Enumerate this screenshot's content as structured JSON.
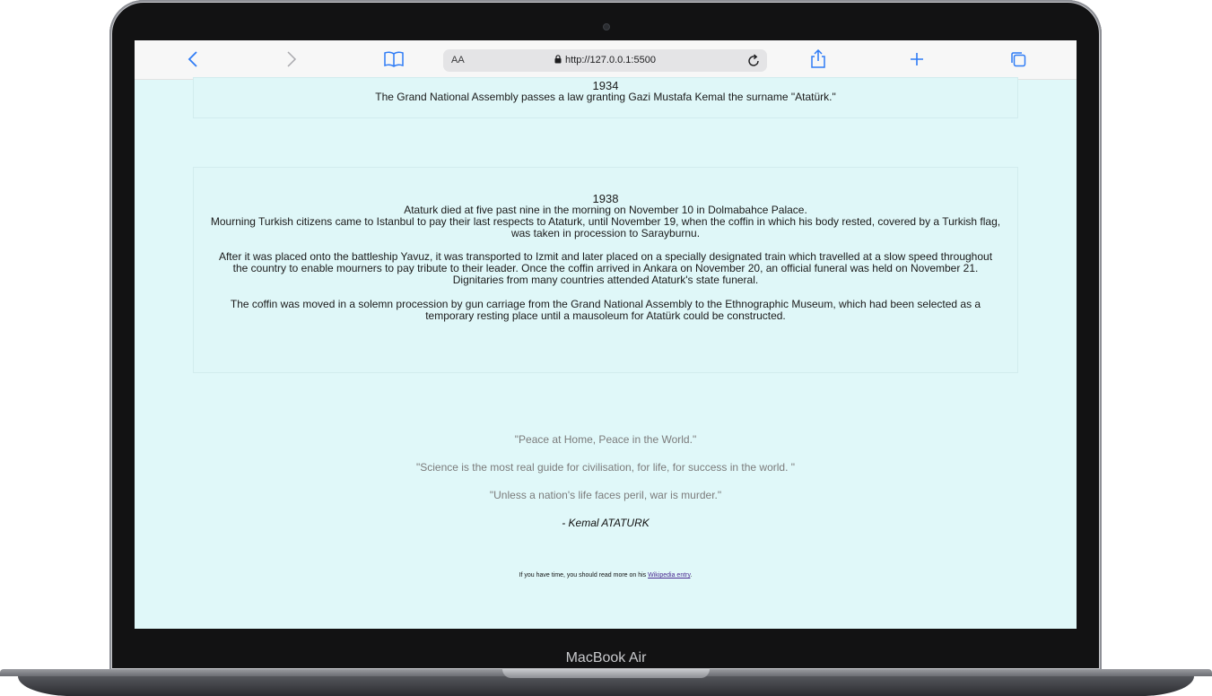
{
  "device": {
    "label": "MacBook Air"
  },
  "browser": {
    "aa_label": "AA",
    "url": "http://127.0.0.1:5500"
  },
  "timeline": [
    {
      "year": "1934",
      "paragraphs": [
        "The Grand National Assembly passes a law granting Gazi Mustafa Kemal the surname \"Atatürk.\""
      ]
    },
    {
      "year": "1938",
      "paragraphs": [
        "Ataturk died at five past nine in the morning on November 10 in Dolmabahce Palace.",
        "Mourning Turkish citizens came to Istanbul to pay their last respects to Ataturk, until November 19, when the coffin in which his body rested, covered by a Turkish flag, was taken in procession to Sarayburnu.",
        "After it was placed onto the battleship Yavuz, it was transported to Izmit and later placed on a specially designated train which travelled at a slow speed throughout the country to enable mourners to pay tribute to their leader. Once the coffin arrived in Ankara on November 20, an official funeral was held on November 21.",
        "Dignitaries from many countries attended Ataturk's state funeral.",
        "The coffin was moved in a solemn procession by gun carriage from the Grand National Assembly to the Ethnographic Museum, which had been selected as a temporary resting place until a mausoleum for Atatürk could be constructed."
      ]
    }
  ],
  "quotes": [
    "\"Peace at Home, Peace in the World.\"",
    "\"Science is the most real guide for civilisation, for life, for success in the world. \"",
    "\"Unless a nation's life faces peril, war is murder.\""
  ],
  "author": "- Kemal ATATURK",
  "footer": {
    "prefix": "If you have time, you should read more on his ",
    "link_text": "Wikipedia entry",
    "suffix": "."
  }
}
